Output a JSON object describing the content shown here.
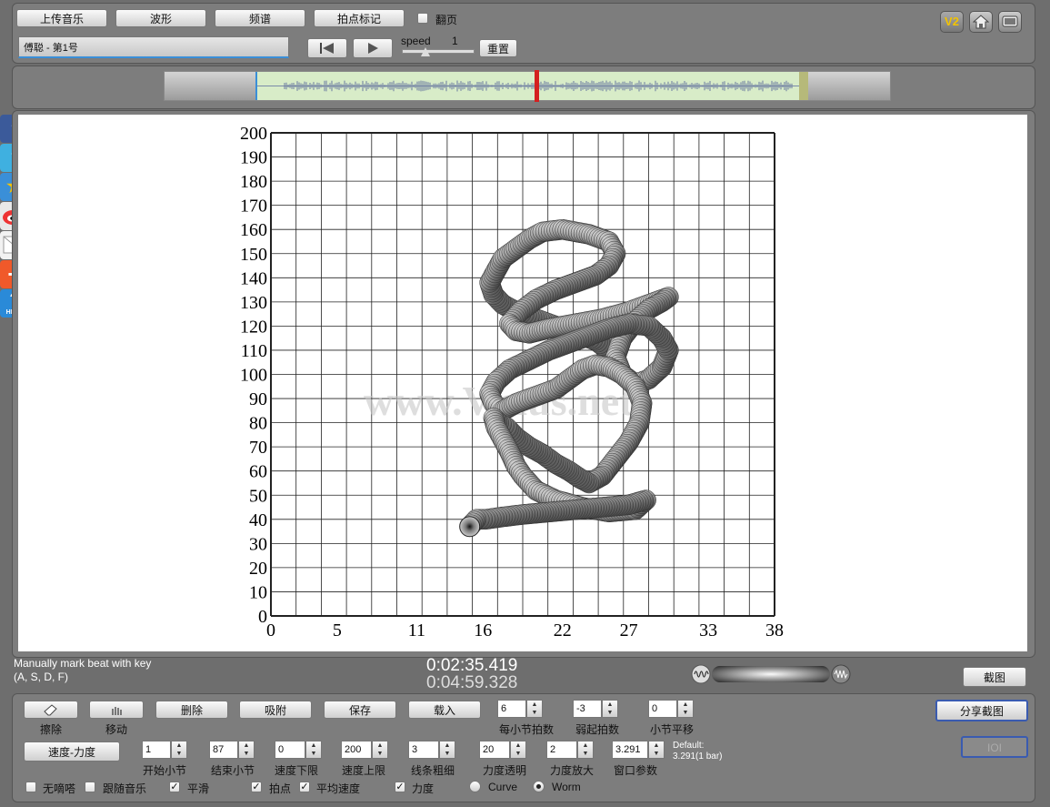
{
  "toolbar": {
    "upload_music": "上传音乐",
    "waveform": "波形",
    "spectrum": "频谱",
    "beat_mark": "拍点标记",
    "page_turn": "翻页",
    "track_name": "傅聪 - 第1号",
    "speed_label": "speed",
    "speed_value": "1",
    "reset": "重置"
  },
  "top_icons": [
    "v2-icon",
    "home-icon",
    "screen-icon"
  ],
  "top_icon_text": {
    "v2": "V2"
  },
  "social": [
    "facebook-icon",
    "twitter-icon",
    "star-icon",
    "weibo-icon",
    "mail-icon",
    "plus-icon",
    "help-icon"
  ],
  "social_text": {
    "facebook": "f",
    "twitter": "t",
    "help": "HELP"
  },
  "status": {
    "hint_line1": "Manually mark beat with key",
    "hint_line2": "(A, S, D, F)",
    "time_current": "0:02:35.419",
    "time_total": "0:04:59.328",
    "screenshot": "截图"
  },
  "watermark": "www.Vmus.net",
  "chart_data": {
    "type": "scatter",
    "title": "",
    "xlabel": "",
    "ylabel": "",
    "xlim": [
      0,
      38
    ],
    "ylim": [
      0,
      200
    ],
    "x_ticks": [
      "0",
      "5",
      "11",
      "16",
      "22",
      "27",
      "33",
      "38"
    ],
    "y_ticks": [
      "0",
      "10",
      "20",
      "30",
      "40",
      "50",
      "60",
      "70",
      "80",
      "90",
      "100",
      "110",
      "120",
      "130",
      "140",
      "150",
      "160",
      "170",
      "180",
      "190",
      "200"
    ],
    "grid": true,
    "series": [
      {
        "style": "worm",
        "x": [
          15.0,
          15.5,
          16.2,
          17.5,
          19.0,
          21.0,
          23.0,
          25.0,
          27.0,
          28.3,
          27.5,
          25.5,
          23.5,
          21.5,
          20.0,
          19.0,
          18.5,
          18.0,
          17.5,
          17.0,
          16.8,
          17.2,
          17.8,
          18.5,
          19.5,
          20.5,
          21.5,
          22.5,
          23.3,
          24.0,
          25.0,
          26.0,
          27.0,
          27.8,
          28.0,
          27.5,
          26.5,
          25.5,
          24.5,
          23.5,
          22.5,
          21.5,
          20.5,
          19.5,
          18.5,
          17.5,
          16.8,
          16.5,
          17.0,
          18.0,
          19.5,
          21.0,
          22.5,
          24.0,
          25.5,
          27.0,
          28.5,
          29.5,
          30.0,
          29.5,
          28.5,
          27.5,
          26.5,
          26.0,
          26.5,
          27.5,
          28.5,
          29.5,
          30.0,
          29.0,
          27.0,
          25.0,
          23.0,
          21.0,
          19.5,
          18.5,
          18.0,
          18.8,
          20.0,
          21.5,
          23.0,
          24.5,
          25.5,
          26.0,
          25.5,
          24.0,
          22.0,
          20.5,
          19.5,
          18.5,
          17.5,
          17.0,
          16.5,
          16.8,
          17.5,
          18.5,
          19.5,
          20.5,
          21.5,
          22.5,
          23.5,
          24.5,
          25.0,
          25.5,
          26.0
        ],
        "y": [
          37,
          40,
          40,
          41,
          42,
          43,
          44,
          45,
          46,
          48,
          44,
          43,
          45,
          48,
          52,
          58,
          62,
          68,
          73,
          78,
          82,
          80,
          78,
          74,
          70,
          67,
          63,
          60,
          57,
          55,
          58,
          65,
          72,
          80,
          88,
          95,
          100,
          103,
          104,
          102,
          98,
          94,
          92,
          90,
          88,
          85,
          88,
          92,
          97,
          102,
          106,
          110,
          113,
          116,
          119,
          121,
          120,
          115,
          110,
          103,
          98,
          96,
          100,
          107,
          115,
          122,
          127,
          130,
          132,
          130,
          126,
          123,
          121,
          119,
          117,
          118,
          121,
          126,
          131,
          135,
          138,
          141,
          145,
          150,
          155,
          158,
          160,
          159,
          156,
          152,
          148,
          143,
          138,
          133,
          129,
          126,
          124,
          122,
          120,
          118,
          116,
          114,
          112,
          109,
          106
        ]
      }
    ]
  },
  "bottom": {
    "erase": "擦除",
    "move": "移动",
    "delete": "删除",
    "snap": "吸附",
    "save": "保存",
    "load": "载入",
    "beats_per_bar_value": "6",
    "beats_per_bar_label": "每小节拍数",
    "pickup_value": "-3",
    "pickup_label": "弱起拍数",
    "bar_shift_value": "0",
    "bar_shift_label": "小节平移",
    "share_screenshot": "分享截图",
    "tempo_dynamics": "速度-力度",
    "start_bar_value": "1",
    "start_bar_label": "开始小节",
    "end_bar_value": "87",
    "end_bar_label": "结束小节",
    "tempo_min_value": "0",
    "tempo_min_label": "速度下限",
    "tempo_max_value": "200",
    "tempo_max_label": "速度上限",
    "line_width_value": "3",
    "line_width_label": "线条粗细",
    "dyn_alpha_value": "20",
    "dyn_alpha_label": "力度透明",
    "dyn_scale_value": "2",
    "dyn_scale_label": "力度放大",
    "window_value": "3.291",
    "window_label": "窗口参数",
    "default_line1": "Default:",
    "default_line2": "3.291(1 bar)",
    "ioi": "IOI",
    "no_click": "无嘀嗒",
    "follow_music": "跟随音乐",
    "smooth": "平滑",
    "beat_point": "拍点",
    "avg_tempo": "平均速度",
    "dynamics": "力度",
    "curve": "Curve",
    "worm": "Worm"
  },
  "colors": {
    "accent_blue": "#3a8fd8",
    "playhead": "#d42020",
    "wave_fill": "#d8ecc8"
  }
}
